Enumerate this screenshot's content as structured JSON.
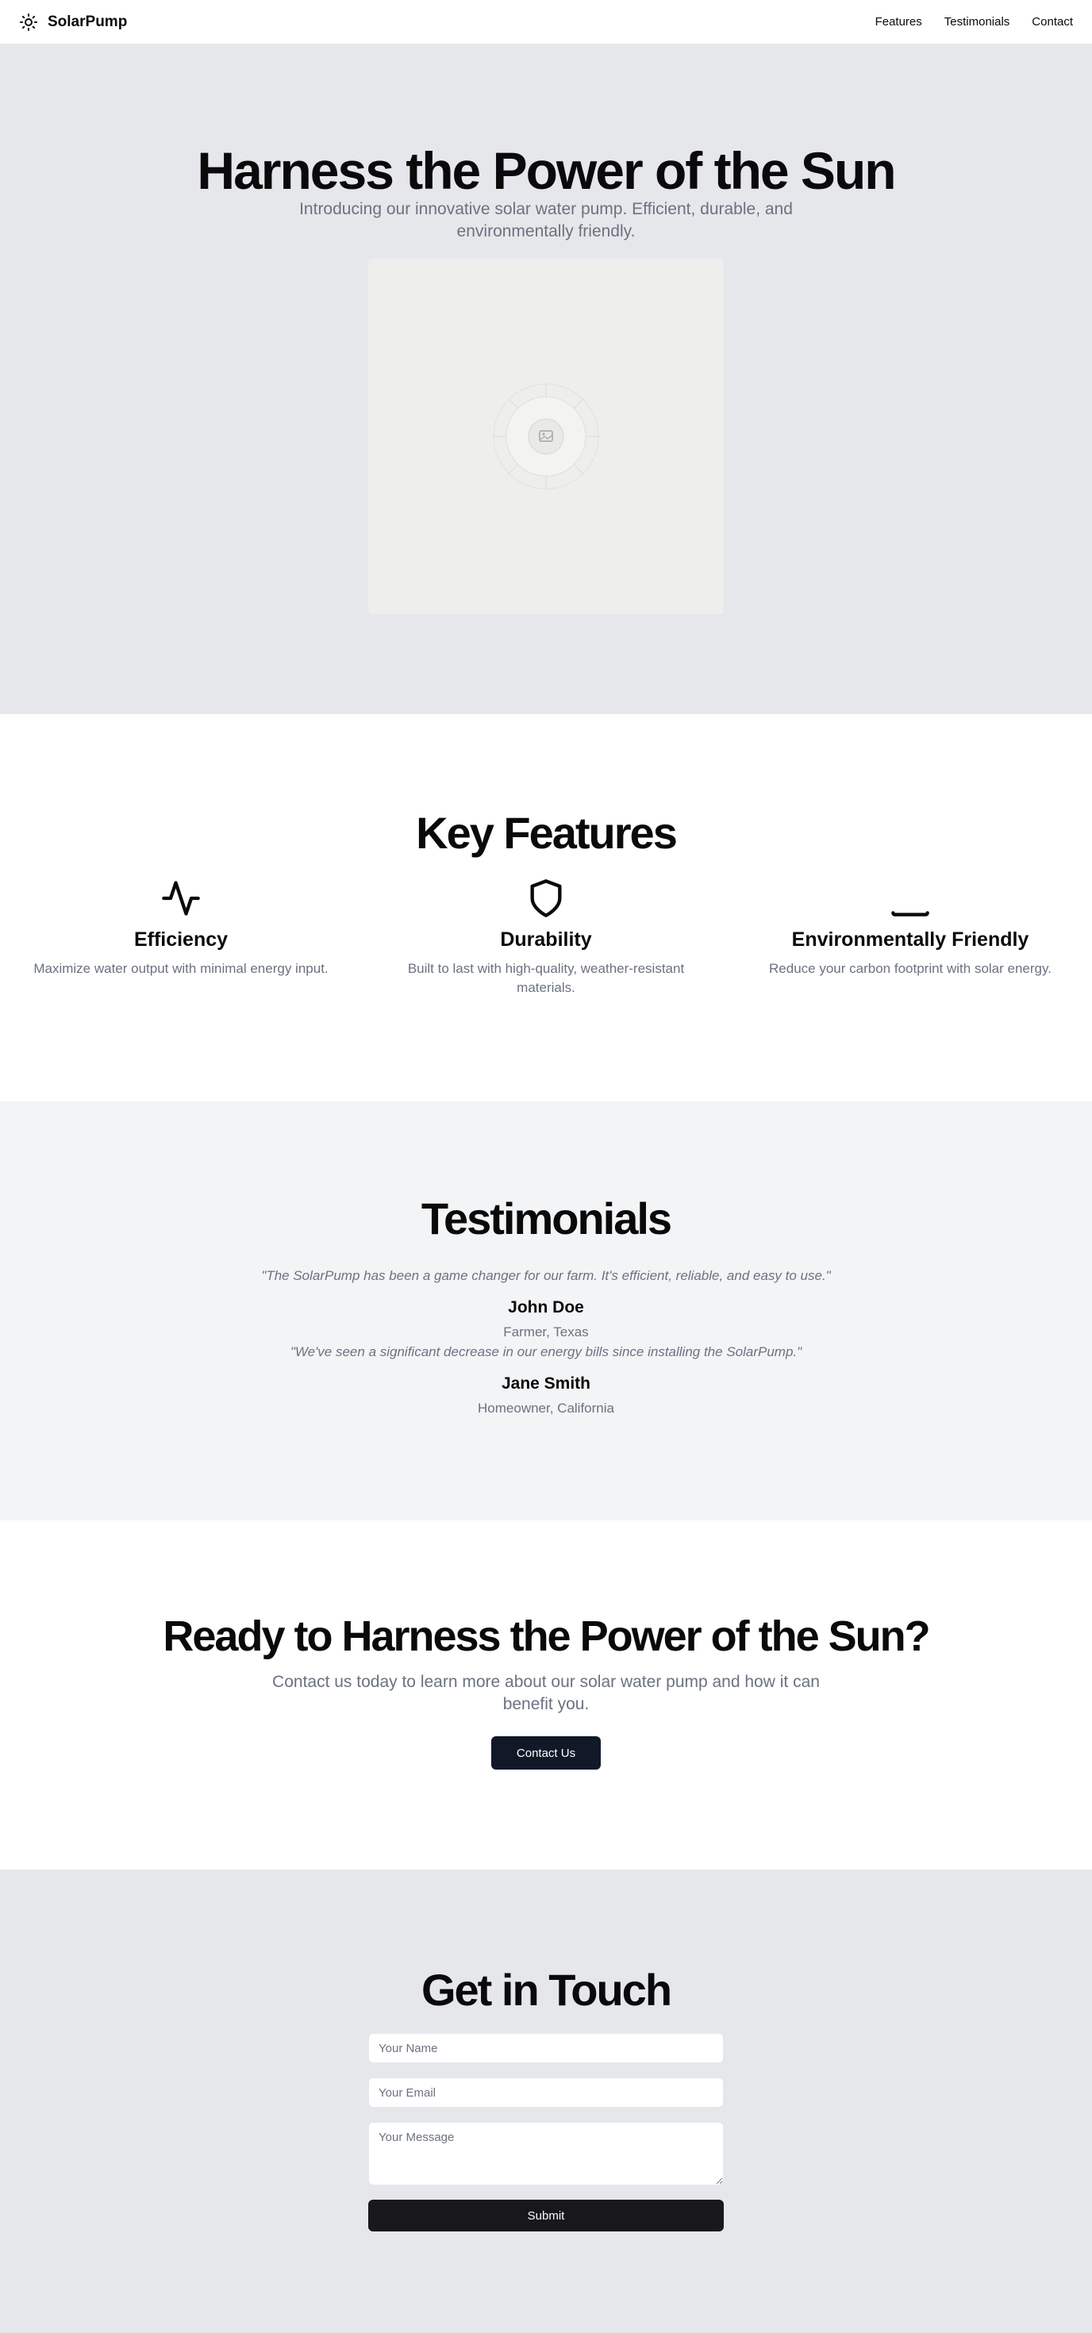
{
  "header": {
    "brand": "SolarPump",
    "brand_icon": "sun-icon",
    "nav": [
      "Features",
      "Testimonials",
      "Contact"
    ]
  },
  "hero": {
    "title": "Harness the Power of the Sun",
    "subtitle": "Introducing our innovative solar water pump. Efficient, durable, and environmentally friendly.",
    "image_icon": "image-placeholder-icon"
  },
  "features": {
    "title": "Key Features",
    "items": [
      {
        "icon": "activity-icon",
        "title": "Efficiency",
        "description": "Maximize water output with minimal energy input."
      },
      {
        "icon": "shield-icon",
        "title": "Durability",
        "description": "Built to last with high-quality, weather-resistant materials."
      },
      {
        "icon": "leaf-icon",
        "title": "Environmentally Friendly",
        "description": "Reduce your carbon footprint with solar energy."
      }
    ]
  },
  "testimonials": {
    "title": "Testimonials",
    "items": [
      {
        "quote": "\"The SolarPump has been a game changer for our farm. It's efficient, reliable, and easy to use.\"",
        "name": "John Doe",
        "role": "Farmer, Texas"
      },
      {
        "quote": "\"We've seen a significant decrease in our energy bills since installing the SolarPump.\"",
        "name": "Jane Smith",
        "role": "Homeowner, California"
      }
    ]
  },
  "cta": {
    "title": "Ready to Harness the Power of the Sun?",
    "subtitle": "Contact us today to learn more about our solar water pump and how it can benefit you.",
    "button": "Contact Us"
  },
  "contact": {
    "title": "Get in Touch",
    "name_placeholder": "Your Name",
    "email_placeholder": "Your Email",
    "message_placeholder": "Your Message",
    "submit": "Submit"
  },
  "colors": {
    "primary_button": "#111827",
    "submit_button": "#18181b",
    "muted_text": "#6b7280",
    "hero_bg": "#e5e7eb",
    "testimonials_bg": "#f3f4f6"
  }
}
